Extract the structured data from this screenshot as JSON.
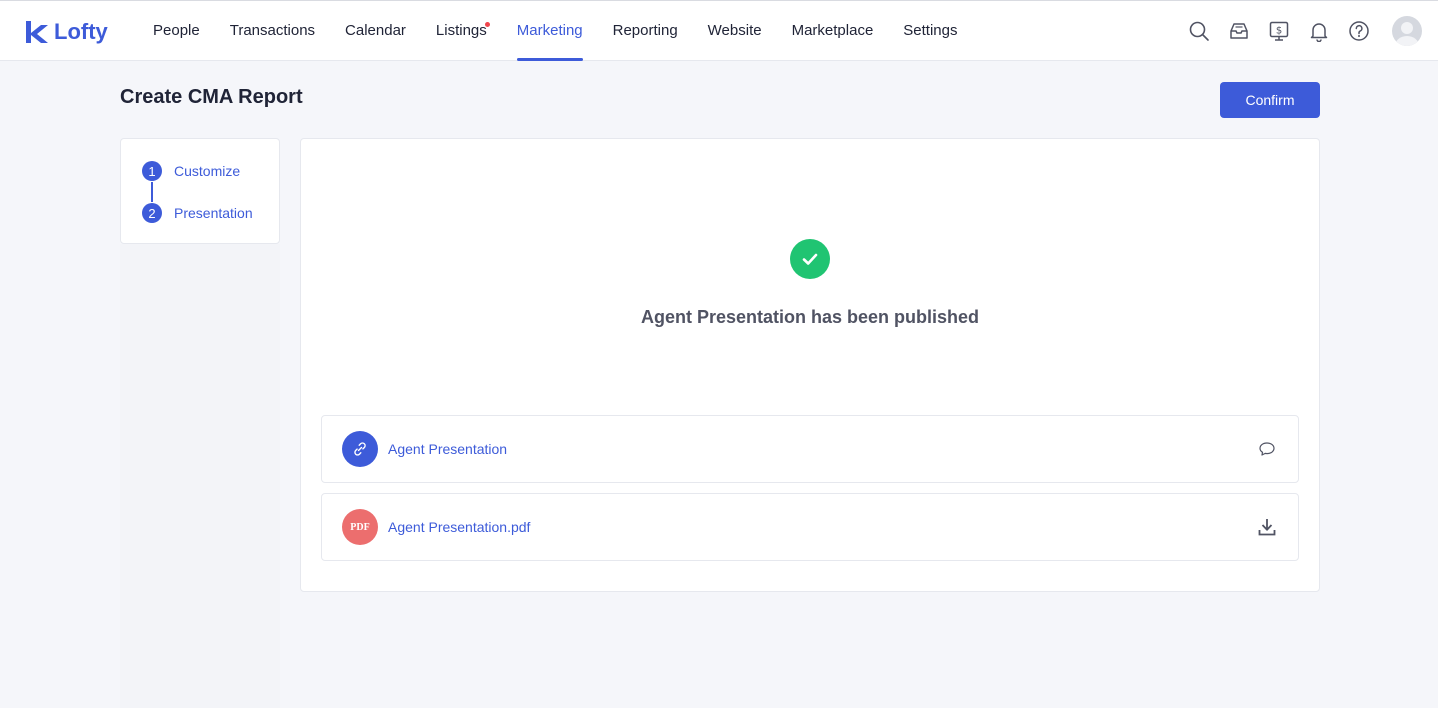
{
  "app": {
    "brand": "Lofty"
  },
  "nav": {
    "items": [
      {
        "label": "People",
        "active": false,
        "dot": false
      },
      {
        "label": "Transactions",
        "active": false,
        "dot": false
      },
      {
        "label": "Calendar",
        "active": false,
        "dot": false
      },
      {
        "label": "Listings",
        "active": false,
        "dot": true
      },
      {
        "label": "Marketing",
        "active": true,
        "dot": false
      },
      {
        "label": "Reporting",
        "active": false,
        "dot": false
      },
      {
        "label": "Website",
        "active": false,
        "dot": false
      },
      {
        "label": "Marketplace",
        "active": false,
        "dot": false
      },
      {
        "label": "Settings",
        "active": false,
        "dot": false
      }
    ],
    "right_icons": [
      "search-icon",
      "inbox-icon",
      "billing-icon",
      "bell-icon",
      "help-icon"
    ]
  },
  "page": {
    "title": "Create CMA Report",
    "confirm_label": "Confirm"
  },
  "steps": [
    {
      "number": "1",
      "label": "Customize"
    },
    {
      "number": "2",
      "label": "Presentation"
    }
  ],
  "result": {
    "message": "Agent Presentation has been published",
    "files": [
      {
        "name": "Agent Presentation",
        "type": "link",
        "icon": "link-icon",
        "action_icon": "comment-icon"
      },
      {
        "name": "Agent Presentation.pdf",
        "type": "pdf",
        "badge": "PDF",
        "icon": "pdf-icon",
        "action_icon": "download-icon"
      }
    ]
  },
  "colors": {
    "accent": "#3d5bd9",
    "success": "#20c472",
    "pdf": "#ec6e6e",
    "notification_dot": "#f0454c"
  }
}
